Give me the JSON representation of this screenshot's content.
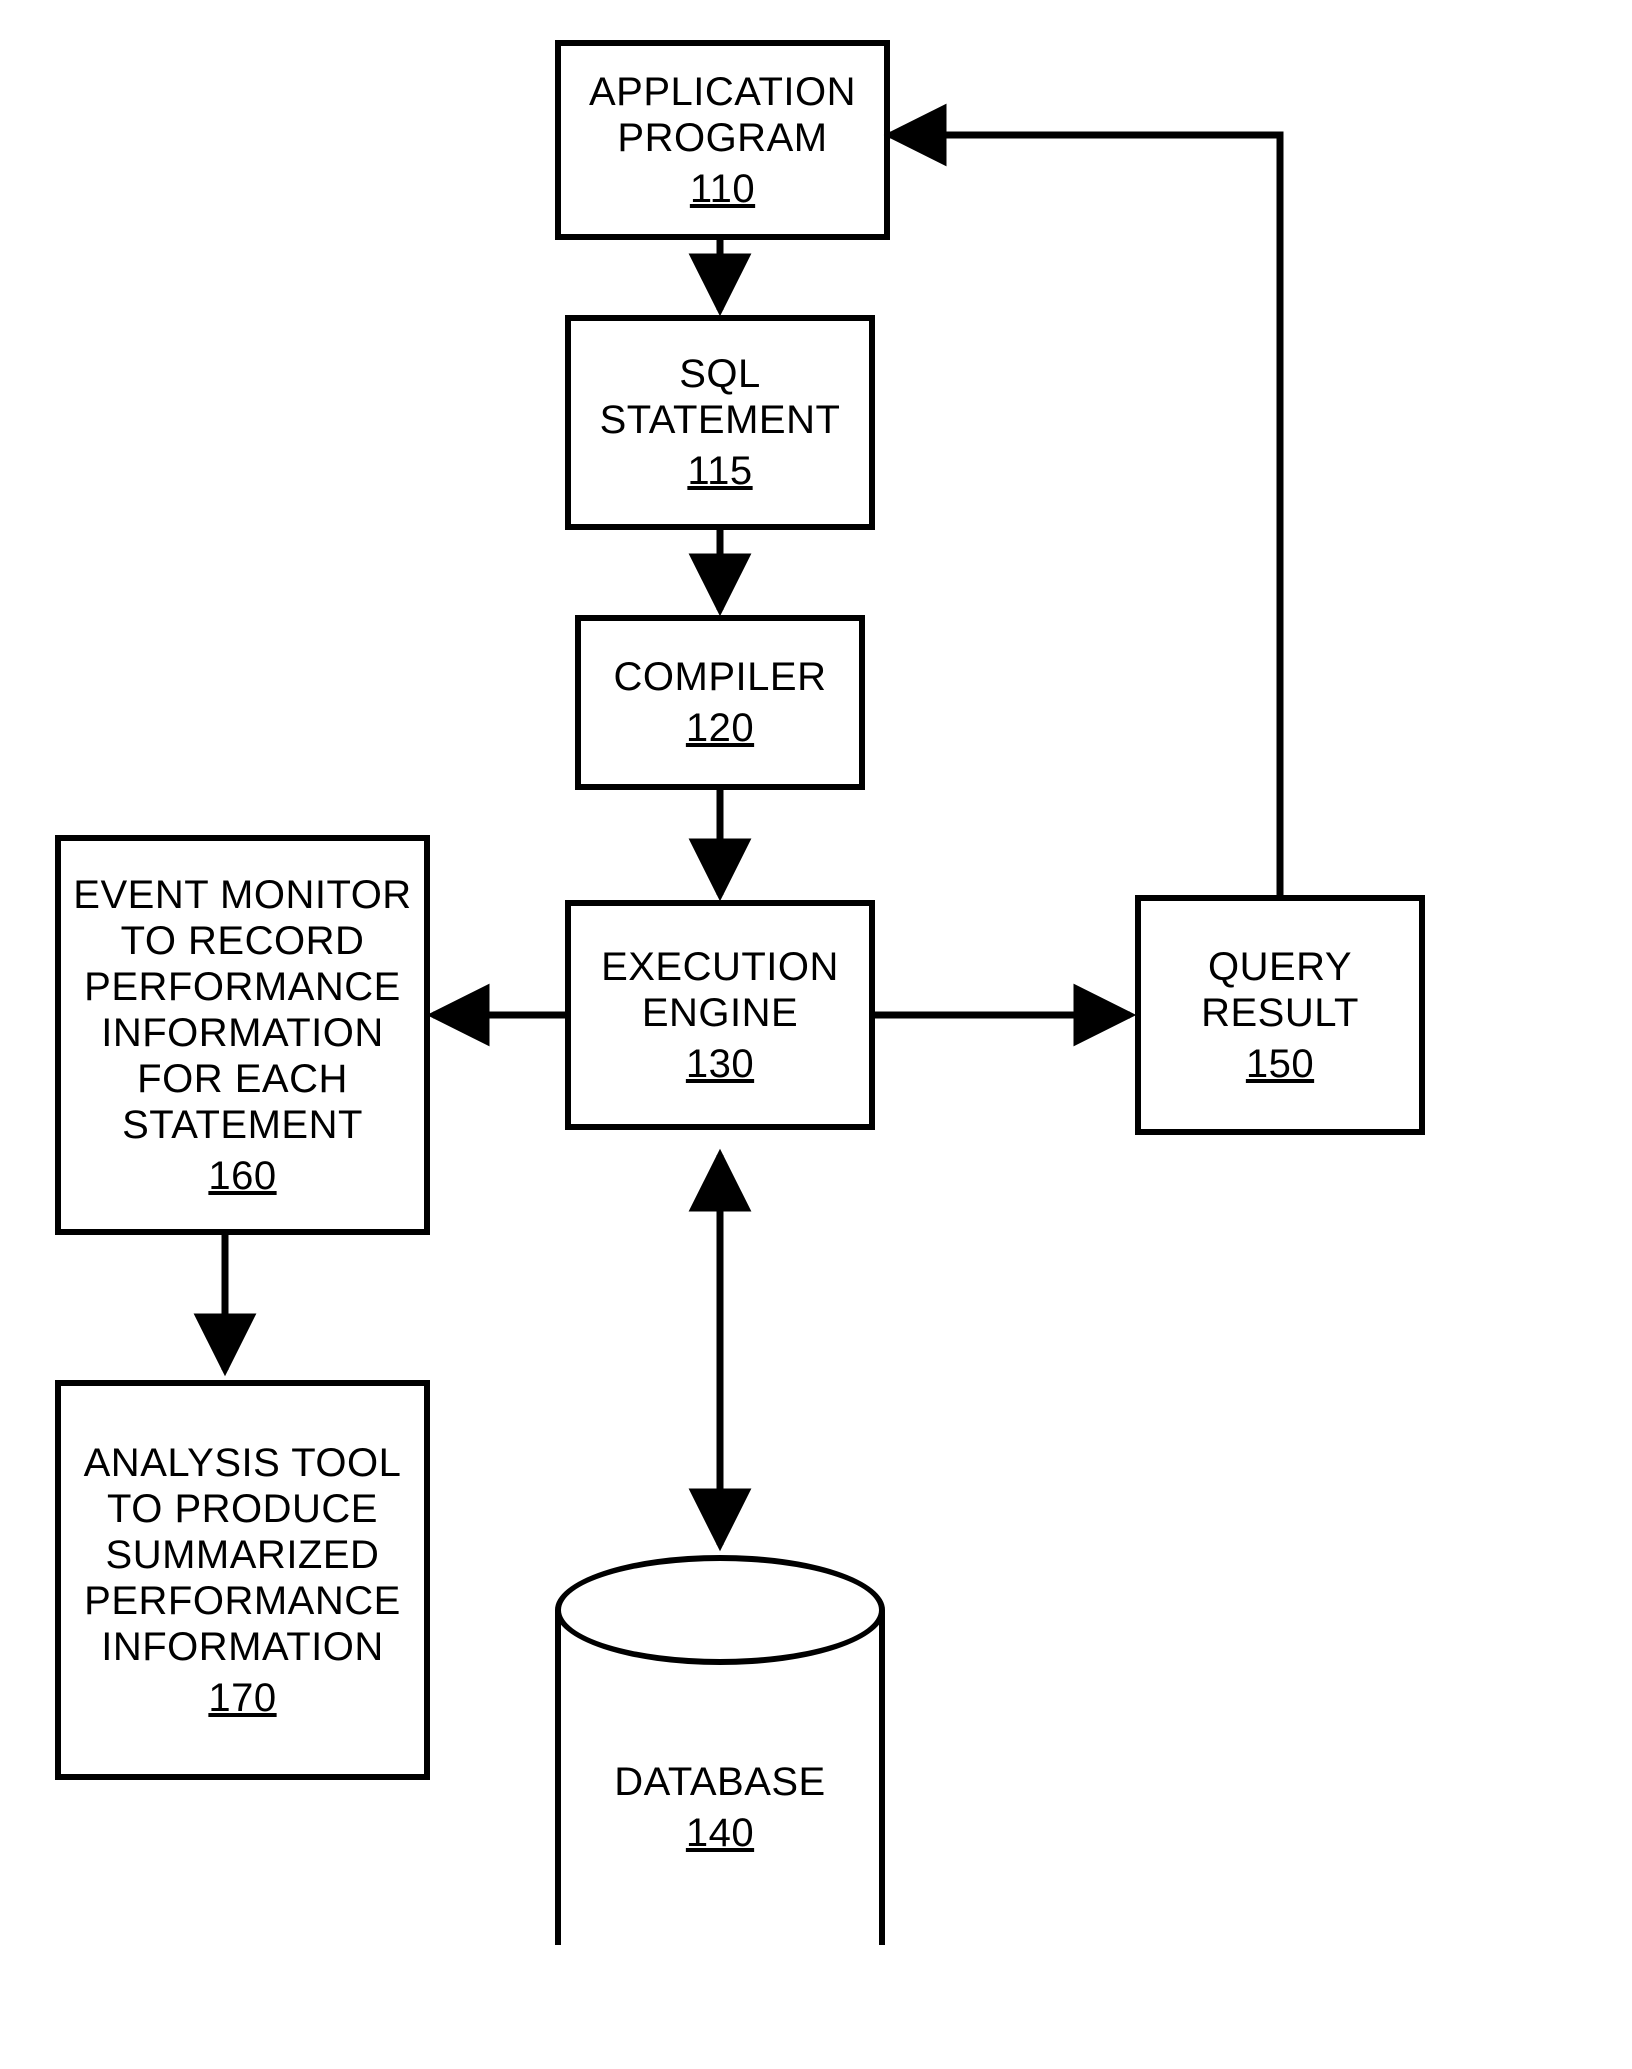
{
  "nodes": {
    "app": {
      "label": "APPLICATION\nPROGRAM",
      "ref": "110"
    },
    "sql": {
      "label": "SQL\nSTATEMENT",
      "ref": "115"
    },
    "compiler": {
      "label": "COMPILER",
      "ref": "120"
    },
    "engine": {
      "label": "EXECUTION\nENGINE",
      "ref": "130"
    },
    "result": {
      "label": "QUERY\nRESULT",
      "ref": "150"
    },
    "monitor": {
      "label": "EVENT MONITOR\nTO RECORD\nPERFORMANCE\nINFORMATION\nFOR EACH\nSTATEMENT",
      "ref": "160"
    },
    "analysis": {
      "label": "ANALYSIS TOOL\nTO PRODUCE\nSUMMARIZED\nPERFORMANCE\nINFORMATION",
      "ref": "170"
    },
    "database": {
      "label": "DATABASE",
      "ref": "140"
    }
  }
}
